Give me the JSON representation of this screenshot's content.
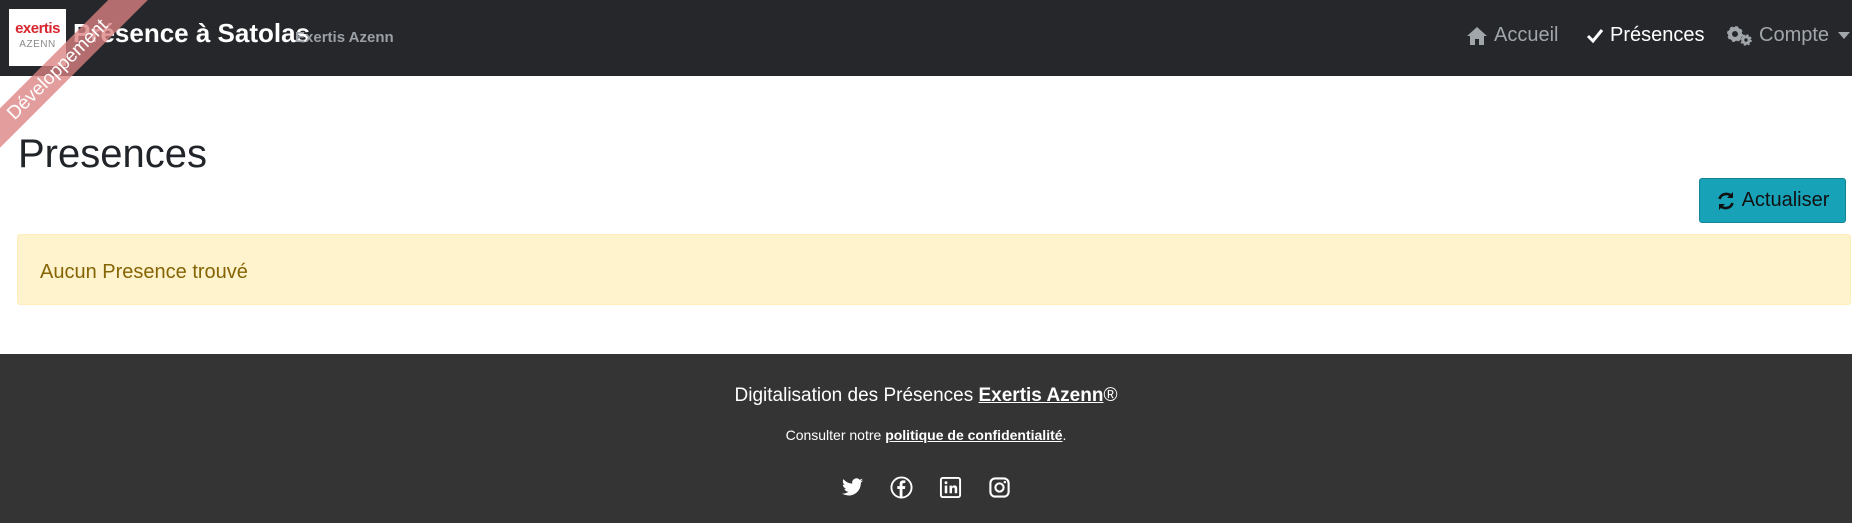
{
  "navbar": {
    "logo_line1": "exertis",
    "logo_line2": "AZENN",
    "title": "Présence à Satolas",
    "subtitle": "Exertis Azenn",
    "items": [
      {
        "label": "Accueil",
        "icon": "home-icon"
      },
      {
        "label": "Présences",
        "icon": "check-icon"
      },
      {
        "label": "Compte",
        "icon": "gears-icon"
      }
    ]
  },
  "ribbon": {
    "label": "Développement"
  },
  "main": {
    "title": "Presences",
    "refresh_label": "Actualiser",
    "refresh_icon": "refresh-icon",
    "alert_text": "Aucun Presence trouvé"
  },
  "footer": {
    "line1_prefix": "Digitalisation des Présences",
    "line1_link": "Exertis Azenn",
    "line1_suffix": "®",
    "line2_prefix": "Consulter notre",
    "line2_link": "politique de confidentialité",
    "line2_suffix": ".",
    "socials": [
      "twitter-icon",
      "facebook-icon",
      "linkedin-icon",
      "instagram-icon"
    ]
  },
  "colors": {
    "navbar": "#25272b",
    "button": "#17a2b8",
    "alert_bg": "#fff3cd",
    "alert_text": "#856404",
    "footer": "#343434",
    "logo_red": "#d7262e"
  }
}
